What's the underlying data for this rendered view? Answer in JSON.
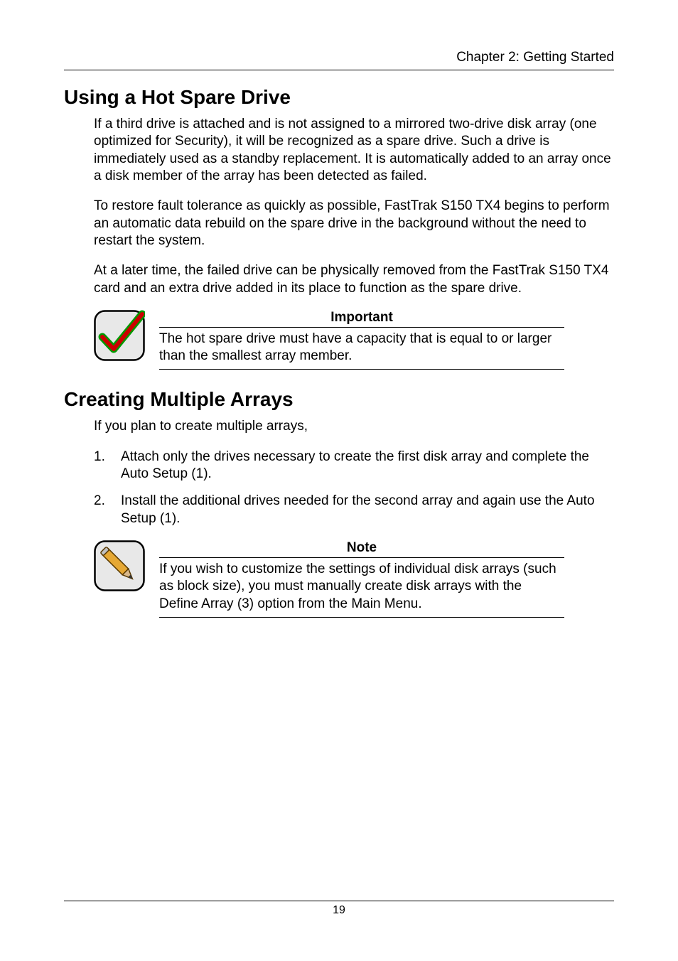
{
  "header": {
    "right": "Chapter 2: Getting Started"
  },
  "section1": {
    "title": "Using a Hot Spare Drive",
    "p1": "If a third drive is attached and is not assigned to a mirrored two-drive disk array (one optimized for Security), it will be recognized as a spare drive. Such a drive is immediately used as a standby replacement. It is automatically added to an array once a disk member of the array has been detected as failed.",
    "p2": "To restore fault tolerance as quickly as possible, FastTrak S150 TX4 begins to perform an automatic data rebuild on the spare drive in the background without the need to restart the system.",
    "p3": "At a later time, the failed drive can be physically removed from the FastTrak S150 TX4 card and an extra drive added in its place to function as the spare drive."
  },
  "important": {
    "title": "Important",
    "text": "The hot spare drive must have a capacity that is equal to or larger than the smallest array member."
  },
  "section2": {
    "title": "Creating Multiple Arrays",
    "intro": "If you plan to create multiple arrays,",
    "steps": [
      "Attach only the drives necessary to create the first disk array and complete the Auto Setup (1).",
      "Install the additional drives needed for the second array and again use the Auto Setup (1)."
    ]
  },
  "note": {
    "title": "Note",
    "text": "If you wish to customize the settings of individual disk arrays (such as block size), you must manually create disk arrays with the Define Array (3) option from the Main Menu."
  },
  "page_number": "19"
}
